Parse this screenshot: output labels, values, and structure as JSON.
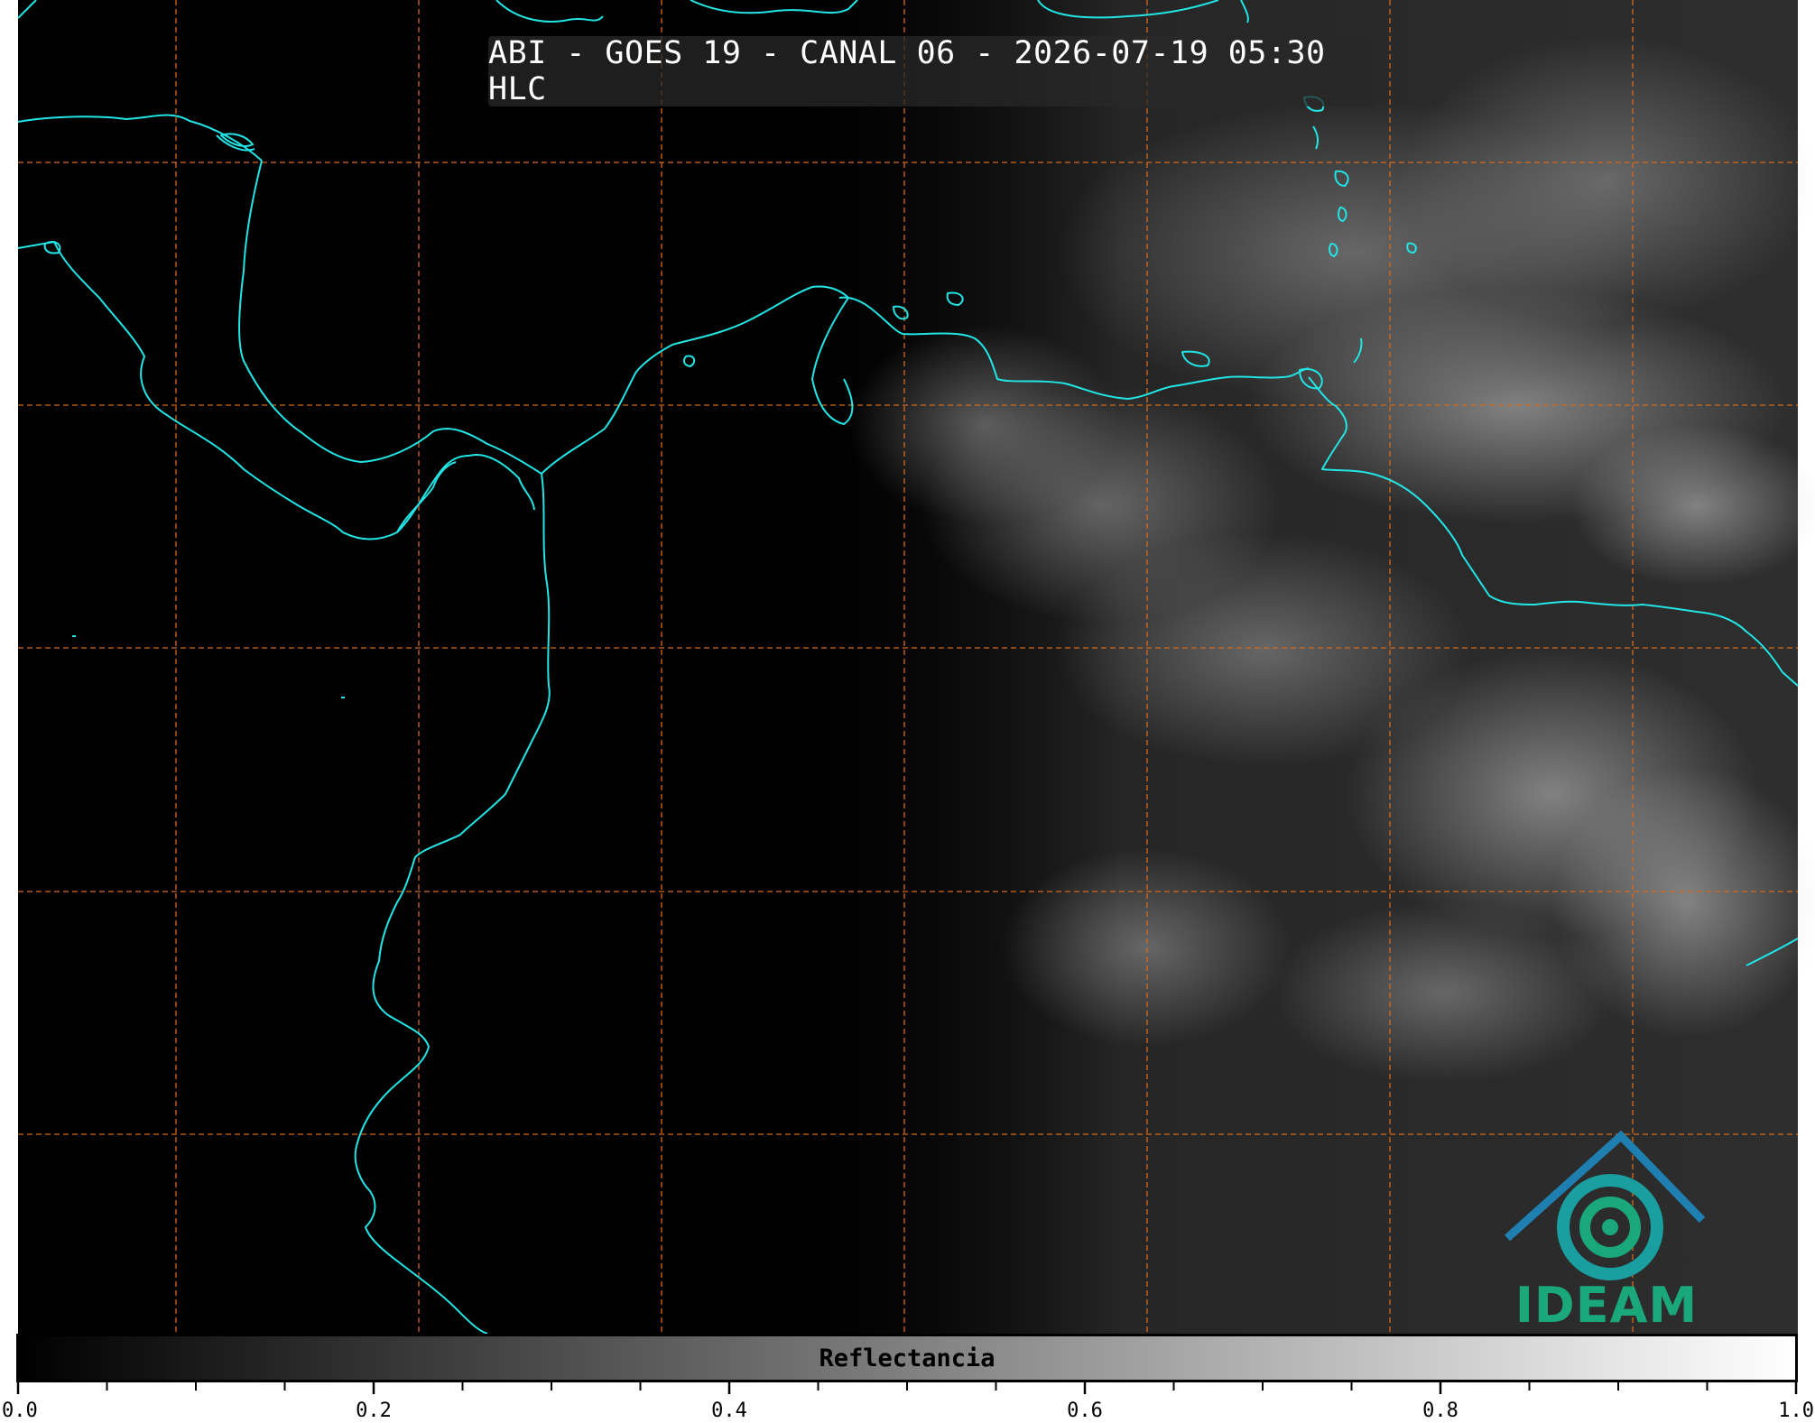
{
  "title": "ABI - GOES 19 - CANAL 06 - 2026-07-19 05:30 HLC",
  "colors": {
    "coastline": "#22e5e5",
    "grid": "#d46a1c",
    "background": "#000000",
    "logo_blue": "#1f6fb5",
    "logo_green": "#1aa77a"
  },
  "grid": {
    "style": "dashed",
    "vertical_lines": 7,
    "horizontal_lines": 5
  },
  "colorbar": {
    "label": "Reflectancia",
    "min": 0.0,
    "max": 1.0,
    "colormap": "grayscale",
    "tick_labels": [
      "0.0",
      "0.2",
      "0.4",
      "0.6",
      "0.8",
      "1.0"
    ]
  },
  "logo": {
    "text": "IDEAM",
    "icon": "ideam-mountain-spiral-logo"
  }
}
